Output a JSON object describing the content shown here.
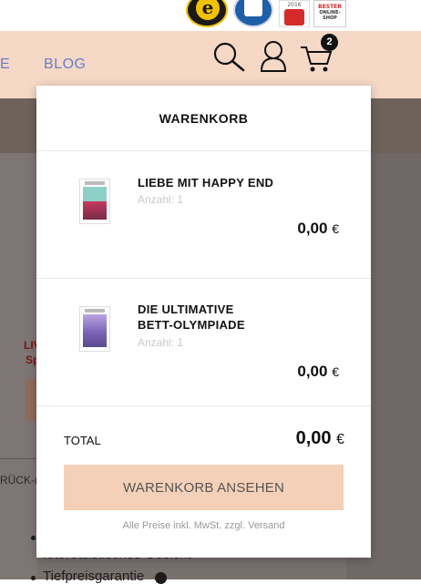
{
  "badges": {
    "trusted_letter": "e",
    "award_year": "2016",
    "bester_line1": "BESTER",
    "bester_line2": "ONLINE-SHOP"
  },
  "nav": {
    "partial_item": "E",
    "blog": "BLOG",
    "cart_count": "2",
    "icons": [
      "search-icon",
      "user-icon",
      "cart-icon"
    ]
  },
  "background_fragments": {
    "red_line_1": "LIV",
    "red_line_2": "Sp",
    "tab_fragment": "RÜCK-(",
    "list_items": [
      "fotorealistisches Gesicht",
      "Tiefpreisgarantie"
    ]
  },
  "mini_cart": {
    "title": "WARENKORB",
    "items": [
      {
        "name": "LIEBE MIT HAPPY END",
        "quantity": "Anzahl: 1",
        "price": "0,00",
        "currency": "€"
      },
      {
        "name_line1": "DIE ULTIMATIVE",
        "name_line2": "BETT-OLYMPIADE",
        "quantity": "Anzahl: 1",
        "price": "0,00",
        "currency": "€"
      }
    ],
    "total_label": "TOTAL",
    "total_value": "0,00",
    "total_currency": "€",
    "view_cart_button": "WARENKORB ANSEHEN",
    "price_note": "Alle Preise inkl. MwSt. zzgl. Versand"
  },
  "colors": {
    "header_bg": "#f5d8c6",
    "nav_link": "#6b7fc4",
    "button_bg": "#f5d0b8",
    "overlay_bg": "#77706d"
  }
}
